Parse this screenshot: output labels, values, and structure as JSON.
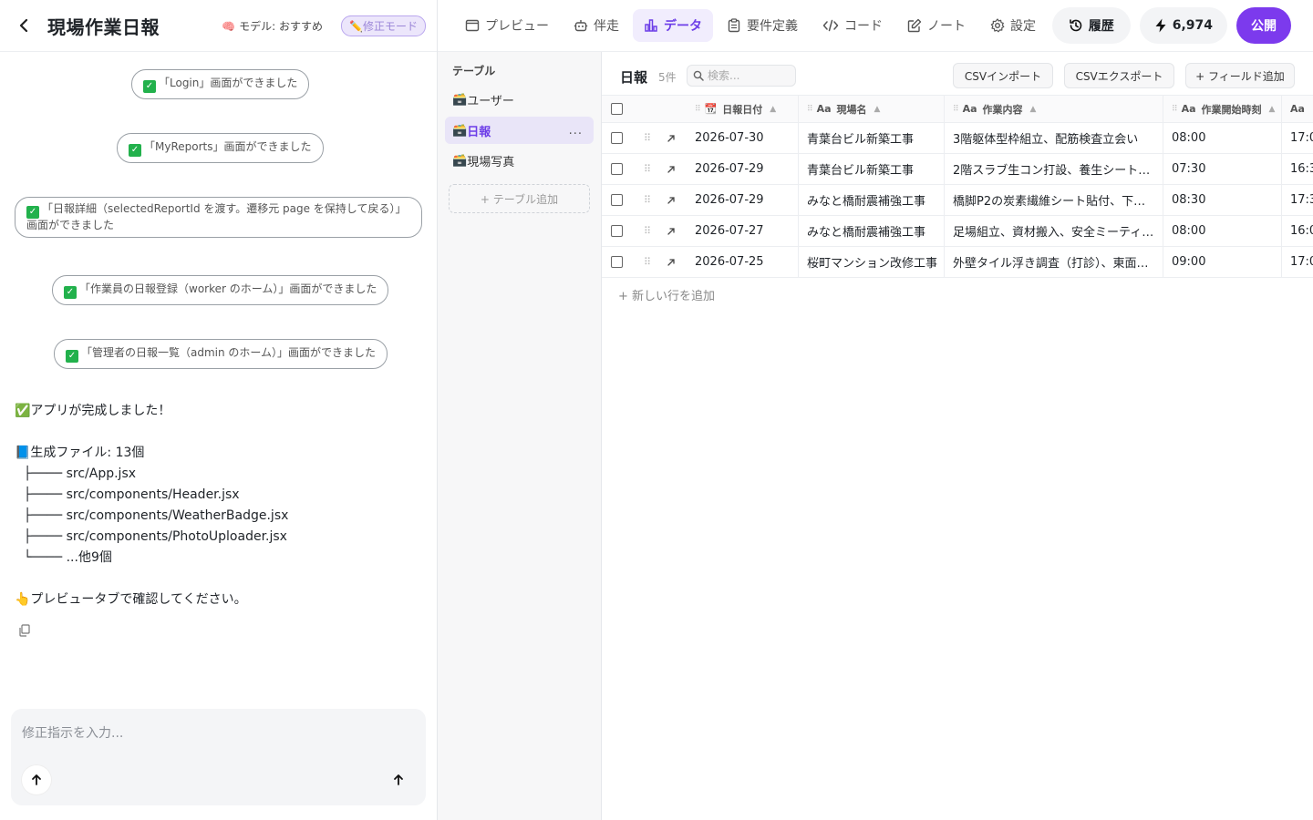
{
  "left": {
    "title": "現場作業日報",
    "model_label": "🧠 モデル: おすすめ",
    "fix_mode": "✏️修正モード",
    "pills": [
      "「Login」画面ができました",
      "「MyReports」画面ができました",
      "「日報詳細（selectedReportId を渡す。遷移元 page を保持して戻る）」画面ができました",
      "「作業員の日報登録（worker のホーム）」画面ができました",
      "「管理者の日報一覧（admin のホーム）」画面ができました"
    ],
    "message": {
      "done": "✅アプリが完成しました！",
      "files_heading": "📘生成ファイル: 13個",
      "files": [
        "├──── src/App.jsx",
        "├──── src/components/Header.jsx",
        "├──── src/components/WeatherBadge.jsx",
        "├──── src/components/PhotoUploader.jsx",
        "└──── ...他9個"
      ],
      "hint": "👆プレビュータブで確認してください。"
    },
    "composer_placeholder": "修正指示を入力..."
  },
  "nav": {
    "tabs": [
      {
        "label": "プレビュー",
        "icon": "window-icon"
      },
      {
        "label": "伴走",
        "icon": "robot-icon"
      },
      {
        "label": "データ",
        "icon": "bar-chart-icon"
      },
      {
        "label": "要件定義",
        "icon": "clipboard-icon"
      },
      {
        "label": "コード",
        "icon": "code-icon"
      },
      {
        "label": "ノート",
        "icon": "edit-icon"
      },
      {
        "label": "設定",
        "icon": "gear-icon"
      }
    ],
    "active_tab": "データ",
    "history_label": "履歴",
    "credits": "6,974",
    "publish_label": "公開",
    "accent": "#7c3aed"
  },
  "tables": {
    "title": "テーブル",
    "items": [
      "ユーザー",
      "日報",
      "現場写真"
    ],
    "active": "日報",
    "more": "...",
    "add_label": "+ テーブル追加"
  },
  "main": {
    "table_name": "日報",
    "row_count": "5件",
    "search_placeholder": "検索...",
    "buttons": {
      "csv_import": "CSVインポート",
      "csv_export": "CSVエクスポート",
      "add_field": "+ フィールド追加"
    },
    "columns": [
      {
        "type": "📆",
        "label": "日報日付"
      },
      {
        "type": "Aa",
        "label": "現場名"
      },
      {
        "type": "Aa",
        "label": "作業内容"
      },
      {
        "type": "Aa",
        "label": "作業開始時刻"
      },
      {
        "type": "Aa",
        "label": ""
      }
    ],
    "rows": [
      [
        "2026-07-30",
        "青葉台ビル新築工事",
        "3階躯体型枠組立、配筋検査立会い",
        "08:00",
        "17:0"
      ],
      [
        "2026-07-29",
        "青葉台ビル新築工事",
        "2階スラブ生コン打設、養生シート…",
        "07:30",
        "16:3"
      ],
      [
        "2026-07-29",
        "みなと橋耐震補強工事",
        "橋脚P2の炭素繊維シート貼付、下…",
        "08:30",
        "17:3"
      ],
      [
        "2026-07-27",
        "みなと橋耐震補強工事",
        "足場組立、資材搬入、安全ミーティ…",
        "08:00",
        "16:0"
      ],
      [
        "2026-07-25",
        "桜町マンション改修工事",
        "外壁タイル浮き調査（打診）、東面…",
        "09:00",
        "17:0"
      ]
    ],
    "add_row_label": "+ 新しい行を追加"
  }
}
